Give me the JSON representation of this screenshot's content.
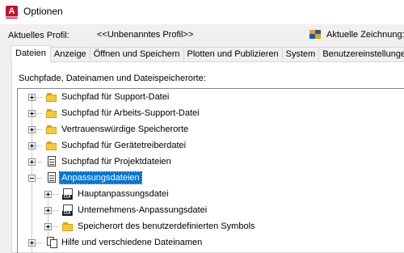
{
  "window": {
    "title": "Optionen",
    "app_icon_letter": "A"
  },
  "profile": {
    "label": "Aktuelles Profil:",
    "value": "<<Unbenanntes Profil>>",
    "drawing_label": "Aktuelle Zeichnung:"
  },
  "tabs": [
    {
      "label": "Dateien",
      "active": true
    },
    {
      "label": "Anzeige",
      "active": false
    },
    {
      "label": "Öffnen und Speichern",
      "active": false
    },
    {
      "label": "Plotten und Publizieren",
      "active": false
    },
    {
      "label": "System",
      "active": false
    },
    {
      "label": "Benutzereinstellungen",
      "active": false
    }
  ],
  "panel": {
    "heading": "Suchpfade, Dateinamen und Dateispeicherorte:"
  },
  "tree": {
    "items": [
      {
        "label": "Suchpfad für Support-Datei",
        "icon": "folder-icon",
        "level": 0,
        "expander": "plus"
      },
      {
        "label": "Suchpfad für Arbeits-Support-Datei",
        "icon": "folder-icon",
        "level": 0,
        "expander": "plus"
      },
      {
        "label": "Vertrauenswürdige Speicherorte",
        "icon": "folder-icon",
        "level": 0,
        "expander": "plus"
      },
      {
        "label": "Suchpfad für Gerätetreiberdatei",
        "icon": "folder-icon",
        "level": 0,
        "expander": "plus"
      },
      {
        "label": "Suchpfad für Projektdateien",
        "icon": "document-icon",
        "level": 0,
        "expander": "plus"
      },
      {
        "label": "Anpassungsdateien",
        "icon": "document-icon",
        "level": 0,
        "expander": "minus",
        "selected": true
      },
      {
        "label": "Hauptanpassungsdatei",
        "icon": "cui-file-icon",
        "level": 1,
        "expander": "plus"
      },
      {
        "label": "Unternehmens-Anpassungsdatei",
        "icon": "cui-file-icon",
        "level": 1,
        "expander": "plus"
      },
      {
        "label": "Speicherort des benutzerdefinierten Symbols",
        "icon": "folder-icon",
        "level": 1,
        "expander": "plus"
      },
      {
        "label": "Hilfe und verschiedene Dateinamen",
        "icon": "stacked-documents-icon",
        "level": 0,
        "expander": "plus"
      }
    ]
  }
}
